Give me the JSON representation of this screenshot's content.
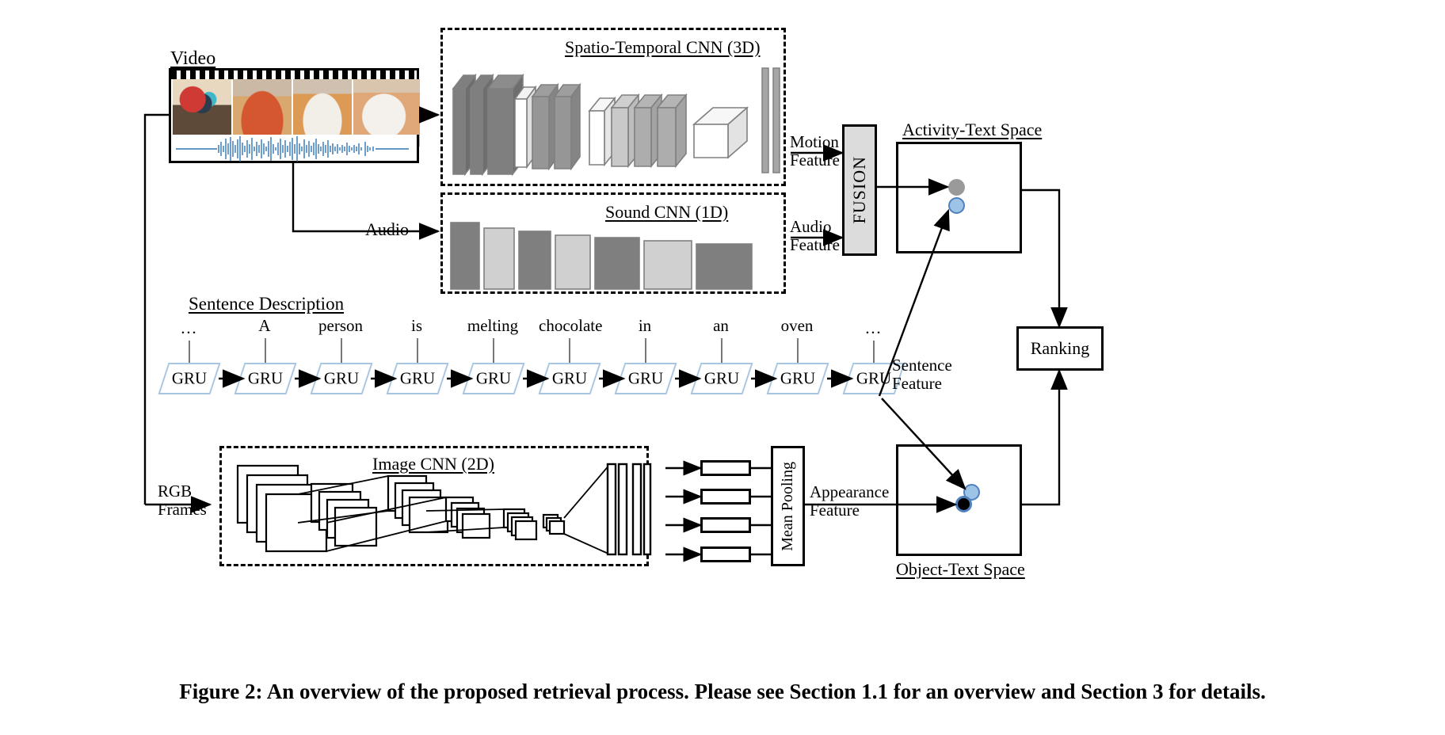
{
  "figure": {
    "caption": "Figure 2: An overview of the proposed retrieval process. Please see Section 1.1 for an overview and Section 3 for details."
  },
  "inputs": {
    "video_label": "Video",
    "audio_label": "Audio",
    "rgb_label_line1": "RGB",
    "rgb_label_line2": "Frames",
    "sentence_label": "Sentence Description"
  },
  "modules": {
    "spatio_temporal_cnn": "Spatio-Temporal CNN (3D)",
    "sound_cnn": "Sound CNN (1D)",
    "image_cnn": "Image CNN (2D)",
    "fusion": "FUSION",
    "mean_pooling": "Mean Pooling",
    "ranking": "Ranking"
  },
  "features": {
    "motion_line1": "Motion",
    "motion_line2": "Feature",
    "audio_line1": "Audio",
    "audio_line2": "Feature",
    "sentence_line1": "Sentence",
    "sentence_line2": "Feature",
    "appearance_line1": "Appearance",
    "appearance_line2": "Feature"
  },
  "spaces": {
    "activity_text": "Activity-Text Space",
    "object_text": "Object-Text Space"
  },
  "sentence": {
    "words": [
      "…",
      "A",
      "person",
      "is",
      "melting",
      "chocolate",
      "in",
      "an",
      "oven",
      "…"
    ],
    "cell_label": "GRU"
  },
  "colors": {
    "gru_border": "#a8c6e2",
    "dot_gray": "#9a9a9a",
    "dot_blue_fill": "#9dc3e6",
    "dot_blue_border": "#4f81bd",
    "dot_black": "#000000",
    "fusion_fill": "#dcdcdc",
    "slab_dark": "#7f7f7f",
    "slab_mid": "#a6a6a6",
    "slab_light": "#d9d9d9",
    "slab_white": "#ffffff",
    "waveform": "#2e75b6"
  },
  "sound_cnn_bars": [
    {
      "shade": "dark"
    },
    {
      "shade": "light"
    },
    {
      "shade": "dark"
    },
    {
      "shade": "light"
    },
    {
      "shade": "dark"
    },
    {
      "shade": "light"
    },
    {
      "shade": "dark"
    }
  ],
  "spatio_slabs": [
    {
      "shade": "dark"
    },
    {
      "shade": "dark"
    },
    {
      "shade": "white"
    },
    {
      "shade": "mid"
    },
    {
      "shade": "mid"
    },
    {
      "shade": "white"
    },
    {
      "shade": "light"
    },
    {
      "shade": "mid"
    },
    {
      "shade": "mid"
    },
    {
      "shade": "white"
    }
  ]
}
